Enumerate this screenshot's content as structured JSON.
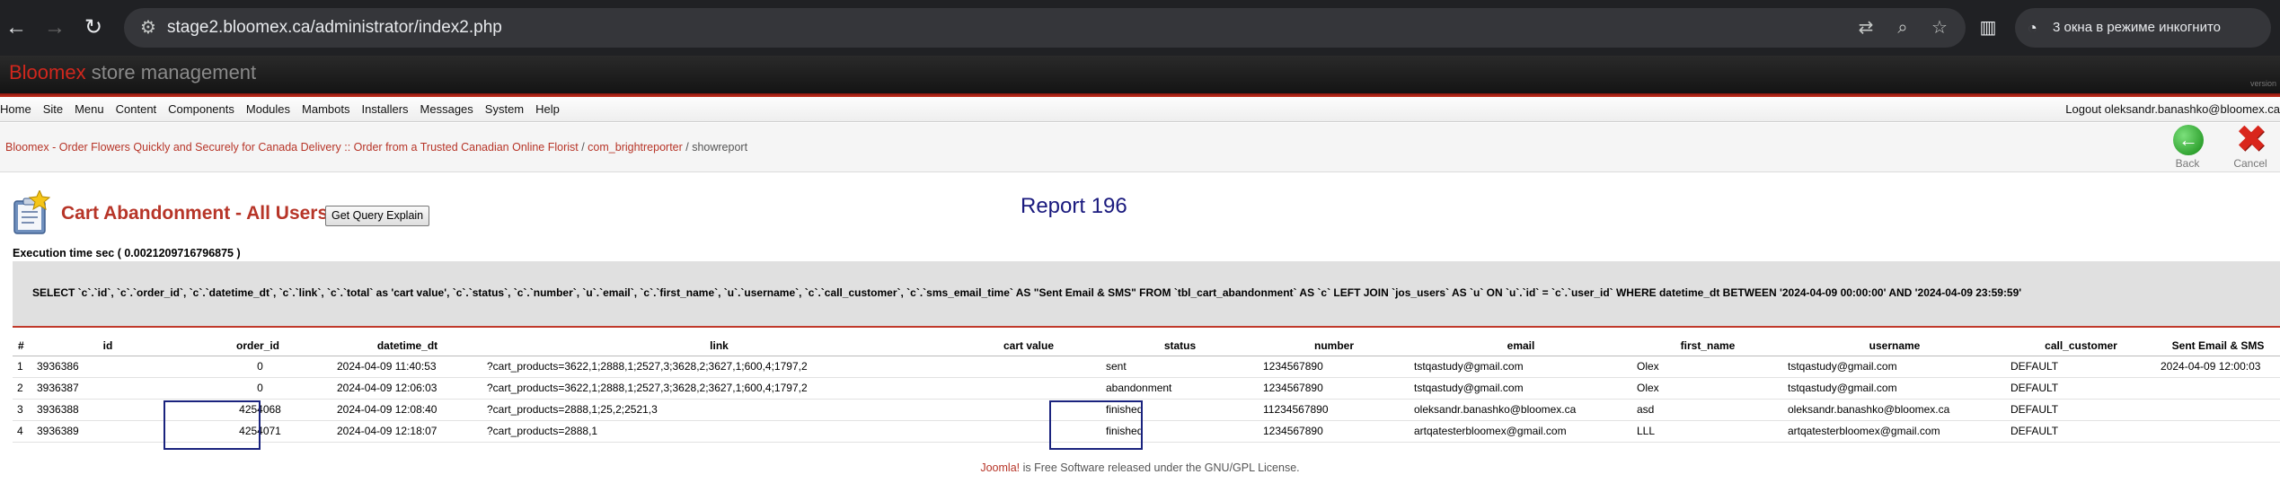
{
  "browser": {
    "url": "stage2.bloomex.ca/administrator/index2.php",
    "incognito": "3 окна в режиме инкогнито"
  },
  "brand": {
    "name": "Bloomex",
    "tagline": "store management",
    "version": "version"
  },
  "menu": [
    "Home",
    "Site",
    "Menu",
    "Content",
    "Components",
    "Modules",
    "Mambots",
    "Installers",
    "Messages",
    "System",
    "Help"
  ],
  "logout": "Logout oleksandr.banashko@bloomex.ca",
  "pathway": {
    "site": "Bloomex - Order Flowers Quickly and Securely for Canada Delivery :: Order from a Trusted Canadian Online Florist",
    "sep": " / ",
    "component": "com_brightreporter",
    "task": "showreport"
  },
  "toolbar": {
    "back": "Back",
    "cancel": "Cancel"
  },
  "heading": "Cart Abandonment - All Users",
  "query_button": "Get Query Explain",
  "report_title": "Report 196",
  "execution": "Execution time sec ( 0.0021209716796875 )",
  "sql": "SELECT `c`.`id`, `c`.`order_id`, `c`.`datetime_dt`, `c`.`link`, `c`.`total` as 'cart value', `c`.`status`, `c`.`number`, `u`.`email`, `c`.`first_name`, `u`.`username`, `c`.`call_customer`, `c`.`sms_email_time` AS \"Sent Email & SMS\" FROM `tbl_cart_abandonment` AS `c` LEFT JOIN `jos_users` AS `u` ON `u`.`id` = `c`.`user_id` WHERE datetime_dt BETWEEN '2024-04-09 00:00:00' AND '2024-04-09 23:59:59'",
  "table": {
    "columns": [
      "#",
      "id",
      "order_id",
      "datetime_dt",
      "link",
      "cart value",
      "status",
      "number",
      "email",
      "first_name",
      "username",
      "call_customer",
      "Sent Email & SMS"
    ],
    "rows": [
      [
        "1",
        "3936386",
        "0",
        "2024-04-09 11:40:53",
        "?cart_products=3622,1;2888,1;2527,3;3628,2;3627,1;600,4;1797,2",
        "",
        "sent",
        "1234567890",
        "tstqastudy@gmail.com",
        "Olex",
        "tstqastudy@gmail.com",
        "DEFAULT",
        "2024-04-09 12:00:03"
      ],
      [
        "2",
        "3936387",
        "0",
        "2024-04-09 12:06:03",
        "?cart_products=3622,1;2888,1;2527,3;3628,2;3627,1;600,4;1797,2",
        "",
        "abandonment",
        "1234567890",
        "tstqastudy@gmail.com",
        "Olex",
        "tstqastudy@gmail.com",
        "DEFAULT",
        ""
      ],
      [
        "3",
        "3936388",
        "4254068",
        "2024-04-09 12:08:40",
        "?cart_products=2888,1;25,2;2521,3",
        "",
        "finished",
        "11234567890",
        "oleksandr.banashko@bloomex.ca",
        "asd",
        "oleksandr.banashko@bloomex.ca",
        "DEFAULT",
        ""
      ],
      [
        "4",
        "3936389",
        "4254071",
        "2024-04-09 12:18:07",
        "?cart_products=2888,1",
        "",
        "finished",
        "1234567890",
        "artqatesterbloomex@gmail.com",
        "LLL",
        "artqatesterbloomex@gmail.com",
        "DEFAULT",
        ""
      ]
    ]
  },
  "footer": {
    "link": "Joomla!",
    "text": " is Free Software released under the GNU/GPL License."
  }
}
